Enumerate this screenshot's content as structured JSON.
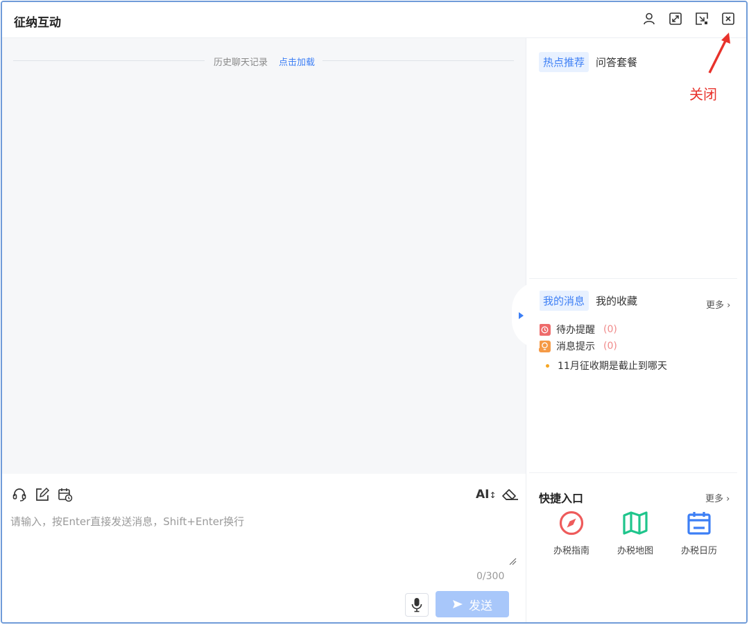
{
  "window": {
    "title": "征纳互动",
    "annotation_label": "关闭"
  },
  "chat": {
    "history_text": "历史聊天记录",
    "history_link": "点击加载"
  },
  "composer": {
    "placeholder": "请输入，按Enter直接发送消息，Shift+Enter换行",
    "counter": "0/300",
    "send_label": "发送",
    "font_tool_label": "AI"
  },
  "side": {
    "hot_tabs": [
      "热点推荐",
      "问答套餐"
    ],
    "msg_tabs": [
      "我的消息",
      "我的收藏"
    ],
    "more_label": "更多",
    "messages": [
      {
        "label": "待办提醒",
        "count": "(0)",
        "color": "#ee6b6b"
      },
      {
        "label": "消息提示",
        "count": "(0)",
        "color": "#f59a46"
      }
    ],
    "notice": "11月征收期是截止到哪天",
    "quick_title": "快捷入口",
    "quick_more": "更多",
    "quick_items": [
      {
        "label": "办税指南",
        "icon": "compass-icon",
        "color": "#ee5b5b"
      },
      {
        "label": "办税地图",
        "icon": "map-icon",
        "color": "#1fc58c"
      },
      {
        "label": "办税日历",
        "icon": "calendar-icon",
        "color": "#3d7ff5"
      }
    ]
  },
  "colors": {
    "accent": "#3d7ff5",
    "annotation": "#e8322b",
    "send_disabled": "#a8c7fa"
  }
}
